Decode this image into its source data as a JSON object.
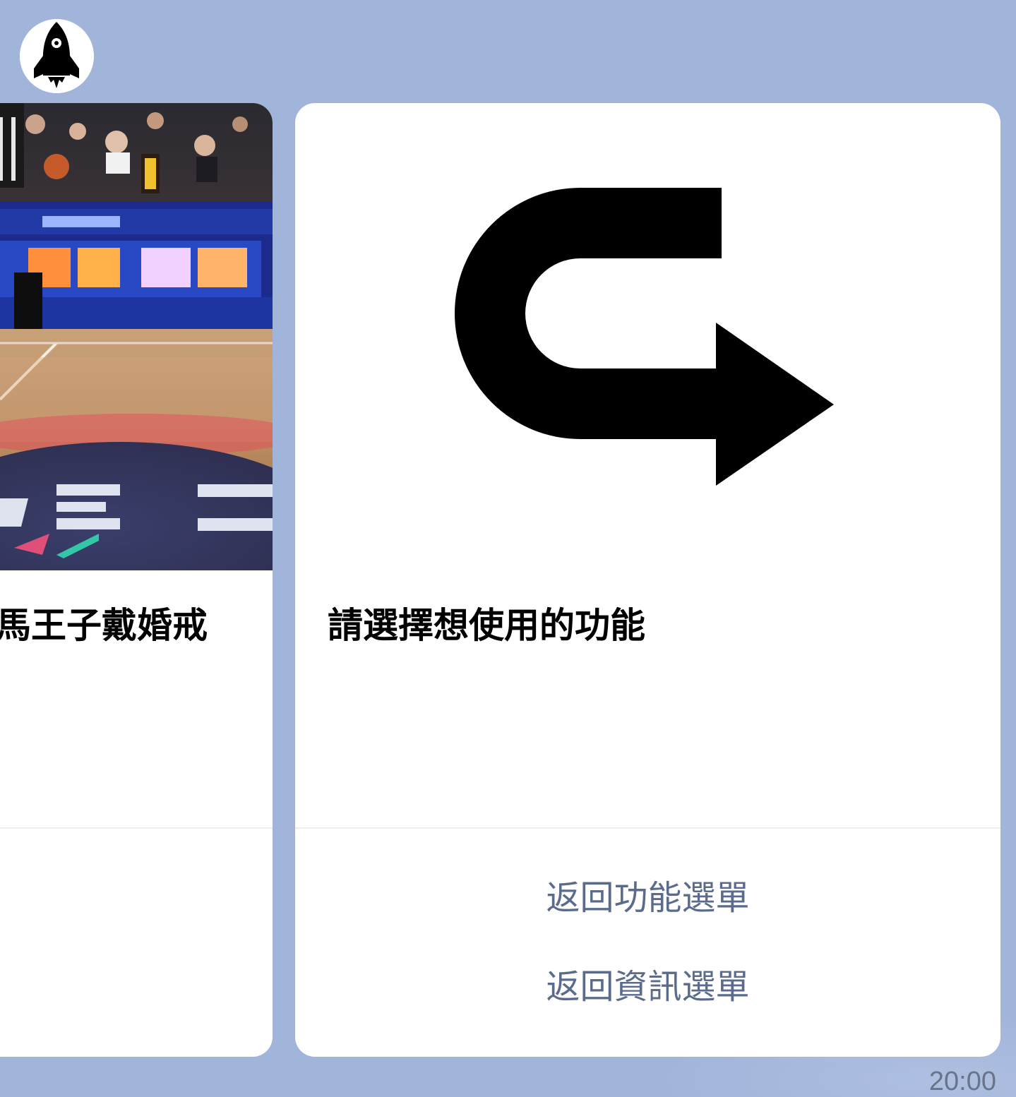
{
  "chat": {
    "avatar_icon": "rocket-icon",
    "timestamp": "20:00"
  },
  "cards": {
    "left": {
      "image_description_icon": "basketball-game-photo",
      "title": "馬王子戴婚戒"
    },
    "right": {
      "image_icon": "u-turn-arrow-icon",
      "title": "請選擇想使用的功能",
      "actions": [
        {
          "label": "返回功能選單"
        },
        {
          "label": "返回資訊選單"
        }
      ]
    }
  },
  "colors": {
    "background": "#a1b4da",
    "card": "#ffffff",
    "link": "#5b6b8c",
    "timestamp": "#6a7489"
  }
}
